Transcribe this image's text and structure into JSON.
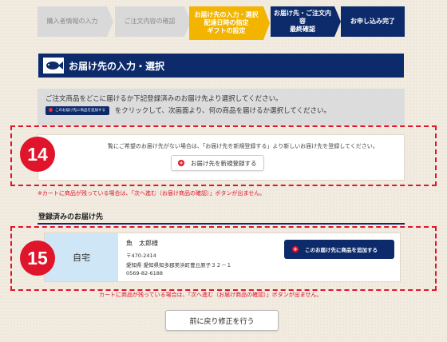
{
  "steps": [
    {
      "label": "購入者情報の入力",
      "state": "inactive"
    },
    {
      "label": "ご注文内容の確認",
      "state": "inactive"
    },
    {
      "label": "お届け先の入力・選択\n配達日時の指定\nギフトの設定",
      "state": "active"
    },
    {
      "label": "お届け先・ご注文内容\n最終確認",
      "state": "upcoming"
    },
    {
      "label": "お申し込み完了",
      "state": "upcoming"
    }
  ],
  "section": {
    "title": "お届け先の入力・選択",
    "icon": "fish-icon"
  },
  "instruction": {
    "line1": "ご注文商品をどこに届けるか下記登録済みのお届け先より選択してください。",
    "inline_button": "このお届け先に商品を追加する",
    "line2": "をクリックして、次画面より、何の商品を届けるか選択してください。"
  },
  "new_address": {
    "message": "覧にご希望のお届け先がない場合は、「お届け先を新規登録する」より新しいお届け先を登録してください。",
    "button": "お届け先を新規登録する"
  },
  "warning_top": "※カートに商品が残っている場合は、「次へ進む（お届け商品の確認）」ボタンが出ません。",
  "registered": {
    "title": "登録済みのお届け先",
    "tag": "自宅",
    "name": "魚　太郎様",
    "postal": "〒470-2414",
    "address": "愛知県 愛知県知多郡美浜町豊丘原子３２－１",
    "phone": "0569-82-6188",
    "add_button": "このお届け先に商品を追加する"
  },
  "warning_bottom": "カートに商品が残っている場合は、「次へ進む（お届け商品の確認）」ボタンが出ません。",
  "back_button": "前に戻り修正を行う",
  "badges": [
    "14",
    "15"
  ],
  "colors": {
    "navy": "#0d2a6b",
    "active_step": "#f3b400",
    "badge_red": "#e0142a",
    "tag_blue": "#cfe6f7"
  }
}
